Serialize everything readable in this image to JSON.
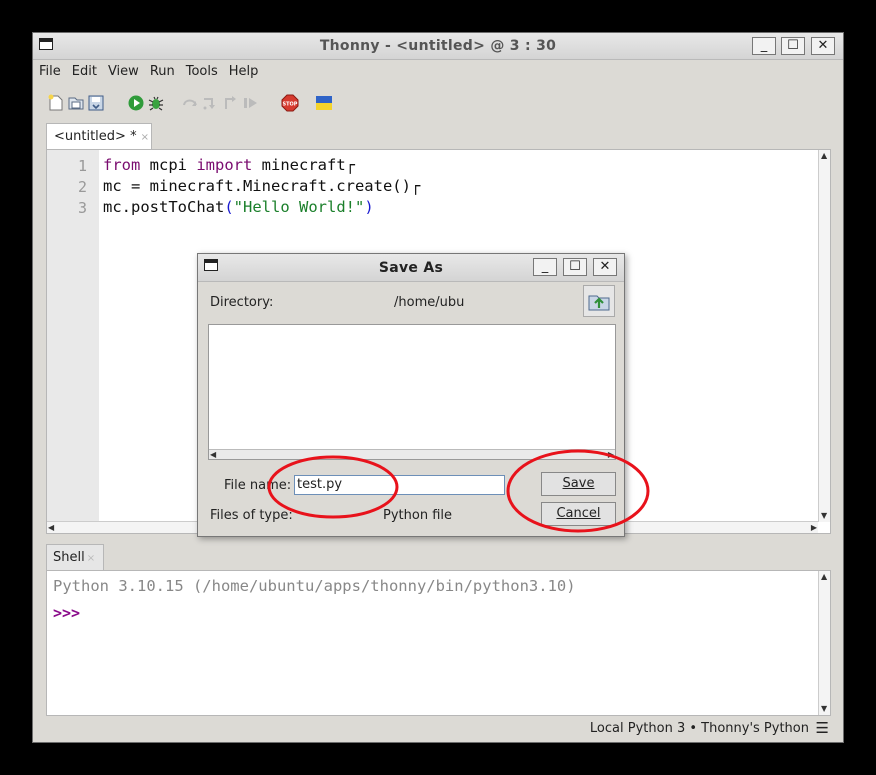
{
  "main_window": {
    "title": "Thonny  -  <untitled>  @  3 : 30",
    "menu": [
      "File",
      "Edit",
      "View",
      "Run",
      "Tools",
      "Help"
    ],
    "toolbar_icons": [
      "new-file-icon",
      "open-file-icon",
      "save-file-icon",
      "run-icon",
      "debug-icon",
      "step-over-icon",
      "step-into-icon",
      "step-out-icon",
      "resume-icon",
      "stop-icon",
      "ukraine-flag-icon"
    ],
    "editor_tab": {
      "label": "<untitled> *",
      "close": "×"
    },
    "code_lines": [
      {
        "num": "1",
        "parts": [
          {
            "t": "from",
            "k": "kw"
          },
          {
            "t": " mcpi ",
            "k": ""
          },
          {
            "t": "import",
            "k": "kw"
          },
          {
            "t": " minecraft",
            "k": ""
          },
          {
            "t": "┌",
            "k": ""
          }
        ]
      },
      {
        "num": "2",
        "parts": [
          {
            "t": "mc = minecraft.Minecraft.create()",
            "k": ""
          },
          {
            "t": "┌",
            "k": ""
          }
        ]
      },
      {
        "num": "3",
        "parts": [
          {
            "t": "mc.postToChat",
            "k": ""
          },
          {
            "t": "(",
            "k": "par"
          },
          {
            "t": "\"Hello World!\"",
            "k": "str"
          },
          {
            "t": ")",
            "k": "par"
          }
        ]
      }
    ],
    "shell_tab": {
      "label": "Shell",
      "close": "×"
    },
    "shell_banner": "Python 3.10.15 (/home/ubuntu/apps/thonny/bin/python3.10)",
    "shell_prompt": ">>>",
    "status": "Local Python 3  •  Thonny's Python",
    "status_menu": "☰"
  },
  "save_dialog": {
    "title": "Save As",
    "directory_label": "Directory:",
    "directory_value": "/home/ubu",
    "file_name_label": "File name:",
    "file_name_value": "test.py",
    "files_of_type_label": "Files of type:",
    "files_of_type_value": "Python file",
    "save_label": "Save",
    "cancel_label": "Cancel"
  },
  "annotation_color": "#e8121b",
  "window_buttons": {
    "minimize": "_",
    "maximize": "☐",
    "close": "✕"
  }
}
